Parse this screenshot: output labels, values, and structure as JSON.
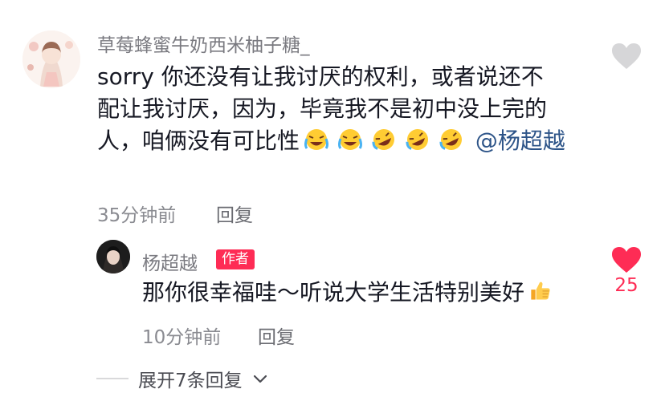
{
  "main_comment": {
    "username": "草莓蜂蜜牛奶西米柚子糖_",
    "text_line1": "sorry 你还没有让我讨厌的权利，或者说还不",
    "text_line2": "配让我讨厌，因为，毕竟我不是初中没上完的",
    "text_line3": "人，咱俩没有可比性",
    "mention": "@杨超越",
    "time": "35分钟前",
    "reply_label": "回复",
    "like_icon": "heart-outline-icon"
  },
  "reply_comment": {
    "username": "杨超越",
    "badge": "作者",
    "text": "那你很幸福哇～听说大学生活特别美好",
    "time": "10分钟前",
    "reply_label": "回复",
    "like_count": "25",
    "like_color": "#fe2c55"
  },
  "expand": {
    "label": "展开7条回复"
  }
}
